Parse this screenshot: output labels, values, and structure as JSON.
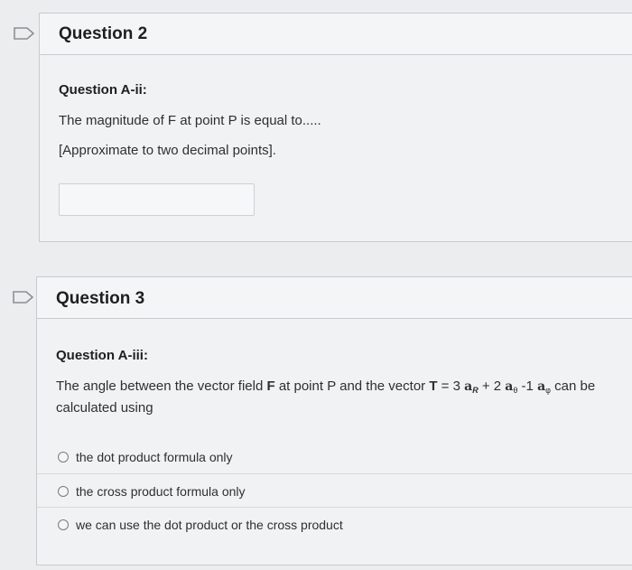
{
  "q2": {
    "title": "Question 2",
    "subtitle": "Question A-ii:",
    "line1": "The magnitude of F at point P is equal to.....",
    "line2": "[Approximate to two decimal points].",
    "answer_value": ""
  },
  "q3": {
    "title": "Question 3",
    "subtitle": "Question A-iii:",
    "stem_pre": "The angle between the vector field ",
    "stem_F": "F",
    "stem_mid": " at point P and the vector ",
    "stem_T": "T",
    "stem_eq": " = 3 ",
    "a_R": "a",
    "a_R_sub": "R",
    "plus2": " + 2 ",
    "a_theta": "a",
    "a_theta_sub": "θ",
    "minus1": " -1 ",
    "a_phi": "a",
    "a_phi_sub": "φ",
    "stem_end": " can be",
    "stem_line2": "calculated using",
    "options": [
      "the dot product formula only",
      "the cross product formula only",
      "we can use the dot product or the cross product"
    ]
  }
}
